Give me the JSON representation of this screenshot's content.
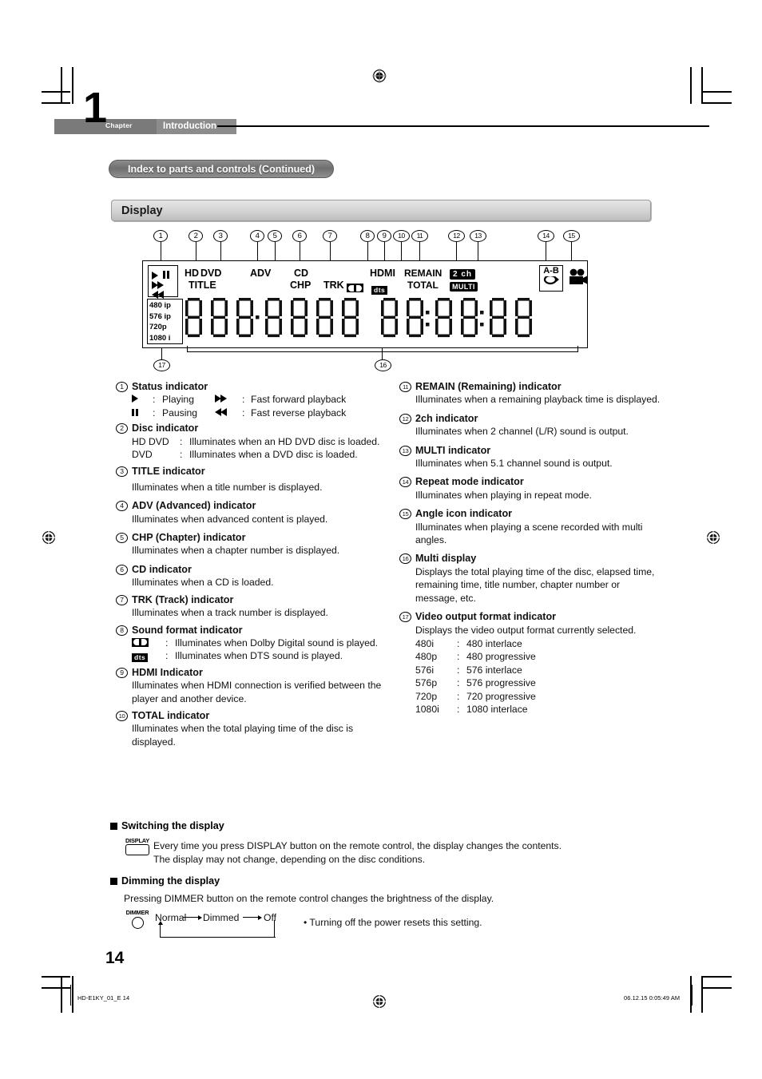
{
  "page": {
    "chapter_word": "Chapter",
    "chapter_number": "1",
    "chapter_title": "Introduction",
    "index_pill": "Index to parts and controls (Continued)",
    "section_title": "Display",
    "page_number": "14",
    "footer_left": "HD-E1KY_01_E  14",
    "footer_right": "06.12.15  0:05:49 AM"
  },
  "figure": {
    "callouts": [
      "1",
      "2",
      "3",
      "4",
      "5",
      "6",
      "7",
      "8",
      "9",
      "10",
      "11",
      "12",
      "13",
      "14",
      "15",
      "16",
      "17"
    ],
    "panel_labels": {
      "hd": "HD",
      "dvd": "DVD",
      "title": "TITLE",
      "adv": "ADV",
      "cd": "CD",
      "chp": "CHP",
      "trk": "TRK",
      "hdmi": "HDMI",
      "remain": "REMAIN",
      "total": "TOTAL",
      "two_ch": "2 ch",
      "multi": "MULTI",
      "ab": "A-B"
    },
    "video_formats": [
      "480 ip",
      "576 ip",
      "720p",
      "1080 i"
    ],
    "icon_names": [
      "play-icon",
      "pause-icon",
      "fast-forward-icon",
      "fast-reverse-icon",
      "dolby-digital-icon",
      "dts-icon",
      "repeat-icon",
      "angle-camera-icon"
    ]
  },
  "left_column": [
    {
      "num": "1",
      "title": "Status indicator",
      "rows": [
        {
          "icon": "play-icon",
          "colon": ":",
          "text": "Playing",
          "icon2": "fast-forward-icon",
          "colon2": ":",
          "text2": "Fast forward playback"
        },
        {
          "icon": "pause-icon",
          "colon": ":",
          "text": "Pausing",
          "icon2": "fast-reverse-icon",
          "colon2": ":",
          "text2": "Fast reverse playback"
        }
      ]
    },
    {
      "num": "2",
      "title": "Disc indicator",
      "defs": [
        {
          "term": "HD DVD",
          "colon": ":",
          "desc": "Illuminates when an HD DVD disc is loaded."
        },
        {
          "term": "DVD",
          "colon": ":",
          "desc": "Illuminates when a DVD disc is loaded."
        }
      ]
    },
    {
      "num": "3",
      "title": "TITLE indicator",
      "body": "Illuminates when a title number is displayed."
    },
    {
      "num": "4",
      "title": "ADV (Advanced) indicator",
      "body": "Illuminates when advanced content is played."
    },
    {
      "num": "5",
      "title": "CHP (Chapter) indicator",
      "body": "Illuminates when a chapter number is displayed."
    },
    {
      "num": "6",
      "title": "CD indicator",
      "body": "Illuminates when a CD is loaded."
    },
    {
      "num": "7",
      "title": "TRK (Track) indicator",
      "body": "Illuminates when a track number is displayed."
    },
    {
      "num": "8",
      "title": "Sound format indicator",
      "icon_defs": [
        {
          "icon": "dolby-digital-icon",
          "colon": ":",
          "desc": "Illuminates when Dolby Digital sound is played."
        },
        {
          "icon": "dts-icon",
          "colon": ":",
          "desc": "Illuminates when DTS sound is played."
        }
      ]
    },
    {
      "num": "9",
      "title": "HDMI Indicator",
      "body": "Illuminates when HDMI connection is verified between the player and another device."
    },
    {
      "num": "10",
      "title": "TOTAL indicator",
      "body": "Illuminates when the total playing time of the disc is displayed."
    }
  ],
  "right_column": [
    {
      "num": "11",
      "title": "REMAIN (Remaining) indicator",
      "body": "Illuminates when a remaining playback time is displayed."
    },
    {
      "num": "12",
      "title": "2ch indicator",
      "body": "Illuminates when 2 channel (L/R) sound is output."
    },
    {
      "num": "13",
      "title": "MULTI indicator",
      "body": "Illuminates when 5.1 channel sound is output."
    },
    {
      "num": "14",
      "title": "Repeat mode indicator",
      "body": "Illuminates when playing in repeat mode."
    },
    {
      "num": "15",
      "title": "Angle icon indicator",
      "body": "Illuminates when playing a scene recorded with multi angles."
    },
    {
      "num": "16",
      "title": "Multi display",
      "body": "Displays the total playing time of the disc, elapsed time, remaining time, title number, chapter number or message, etc."
    },
    {
      "num": "17",
      "title": "Video output format indicator",
      "body": "Displays the video output format currently selected.",
      "formats": [
        {
          "code": "480i",
          "colon": ":",
          "desc": "480 interlace"
        },
        {
          "code": "480p",
          "colon": ":",
          "desc": "480 progressive"
        },
        {
          "code": "576i",
          "colon": ":",
          "desc": "576 interlace"
        },
        {
          "code": "576p",
          "colon": ":",
          "desc": "576 progressive"
        },
        {
          "code": "720p",
          "colon": ":",
          "desc": "720 progressive"
        },
        {
          "code": "1080i",
          "colon": ":",
          "desc": "1080 interlace"
        }
      ]
    }
  ],
  "switching": {
    "heading": "Switching the display",
    "button_label": "DISPLAY",
    "line1": "Every time you press DISPLAY button on the remote control, the display changes the contents.",
    "line2": "The display may not change, depending on the disc conditions."
  },
  "dimming": {
    "heading": "Dimming the display",
    "button_label": "DIMMER",
    "intro": "Pressing DIMMER button on the remote control changes the brightness of the display.",
    "states": [
      "Normal",
      "Dimmed",
      "Off"
    ],
    "note": "• Turning off the power resets this setting."
  }
}
